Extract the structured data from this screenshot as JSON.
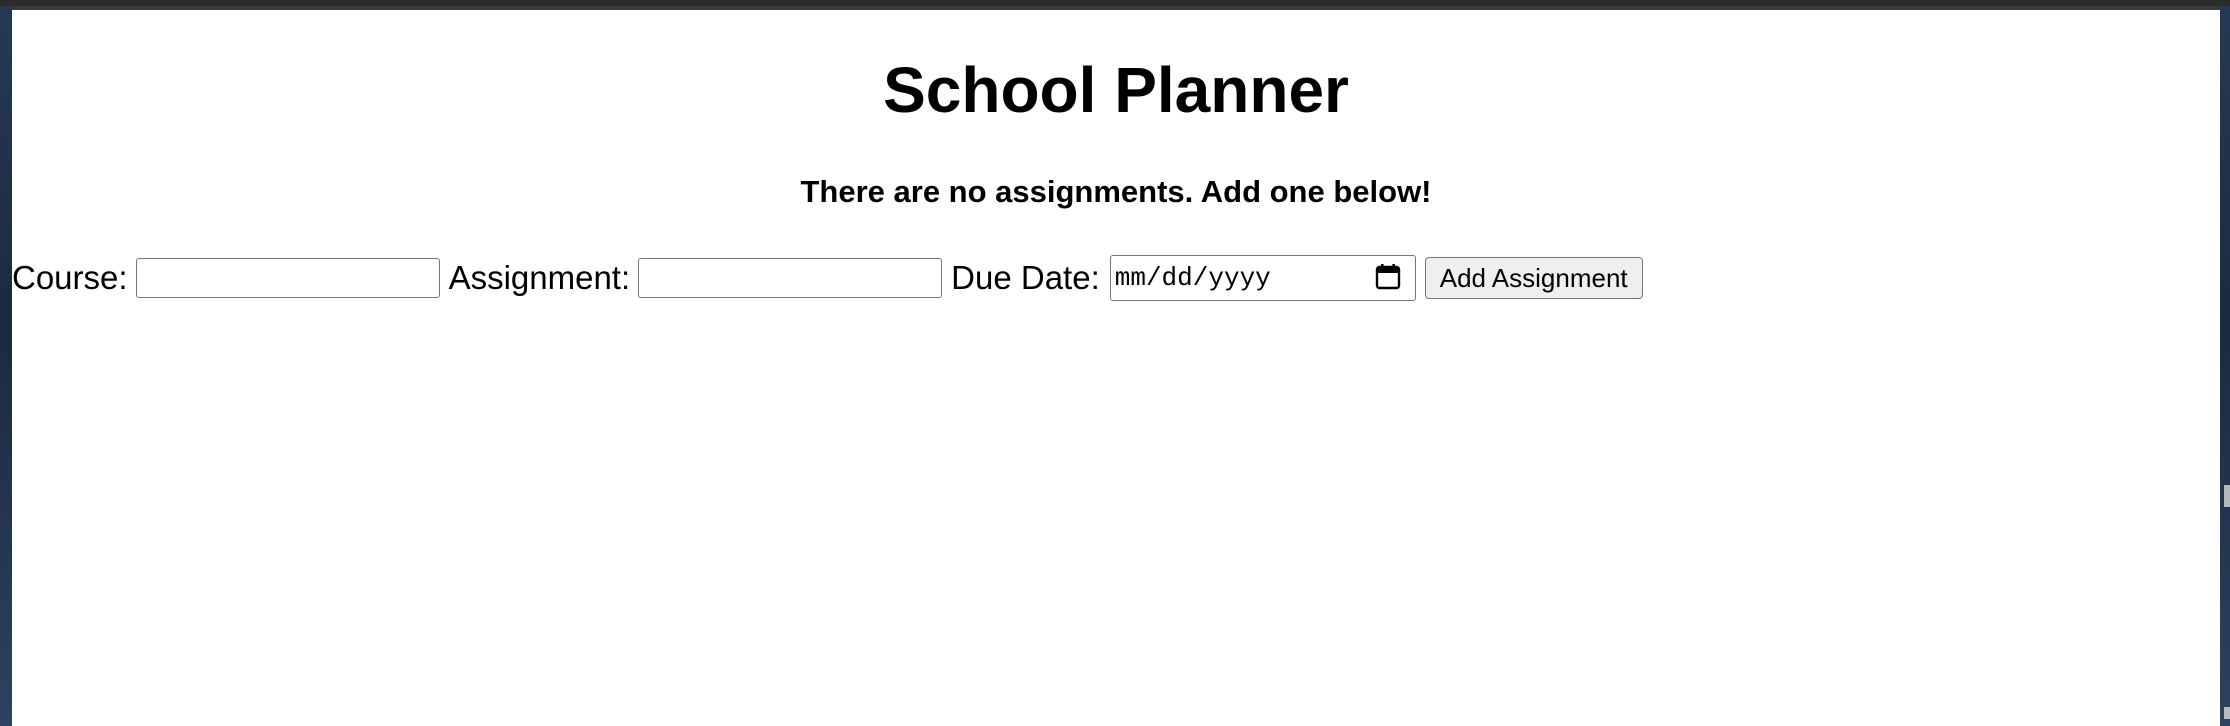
{
  "page": {
    "title": "School Planner",
    "empty_message": "There are no assignments. Add one below!"
  },
  "form": {
    "course_label": "Course:",
    "course_value": "",
    "assignment_label": "Assignment:",
    "assignment_value": "",
    "due_date_label": "Due Date:",
    "due_date_placeholder": "mm/dd/yyyy",
    "submit_label": "Add Assignment"
  },
  "icons": {
    "date_picker": "calendar-icon"
  }
}
